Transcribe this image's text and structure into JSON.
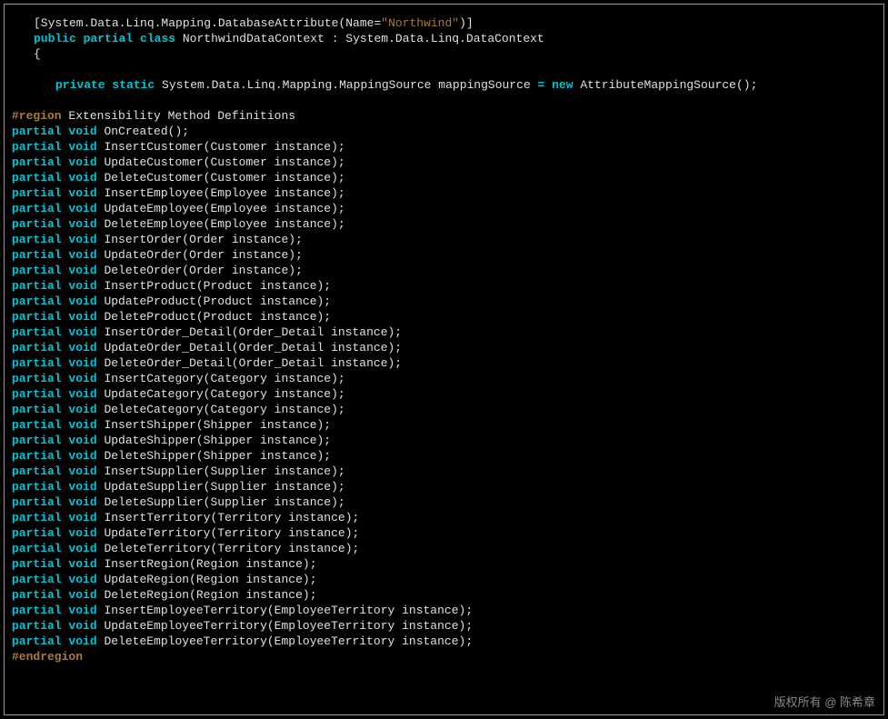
{
  "attr_line": {
    "open": "[System.Data.Linq.Mapping.DatabaseAttribute(Name=",
    "str": "\"Northwind\"",
    "close": ")]"
  },
  "class_line": {
    "k1": "public",
    "k2": "partial",
    "k3": "class",
    "name": " NorthwindDataContext : System.Data.Linq.DataContext"
  },
  "brace": "{",
  "field_line": {
    "k1": "private",
    "k2": "static",
    "type": " System.Data.Linq.Mapping.MappingSource mappingSource ",
    "eq": "=",
    "k3": " new",
    "rest": " AttributeMappingSource();"
  },
  "region": {
    "kw": "#region",
    "txt": " Extensibility Method Definitions"
  },
  "partials": [
    "OnCreated();",
    "InsertCustomer(Customer instance);",
    "UpdateCustomer(Customer instance);",
    "DeleteCustomer(Customer instance);",
    "InsertEmployee(Employee instance);",
    "UpdateEmployee(Employee instance);",
    "DeleteEmployee(Employee instance);",
    "InsertOrder(Order instance);",
    "UpdateOrder(Order instance);",
    "DeleteOrder(Order instance);",
    "InsertProduct(Product instance);",
    "UpdateProduct(Product instance);",
    "DeleteProduct(Product instance);",
    "InsertOrder_Detail(Order_Detail instance);",
    "UpdateOrder_Detail(Order_Detail instance);",
    "DeleteOrder_Detail(Order_Detail instance);",
    "InsertCategory(Category instance);",
    "UpdateCategory(Category instance);",
    "DeleteCategory(Category instance);",
    "InsertShipper(Shipper instance);",
    "UpdateShipper(Shipper instance);",
    "DeleteShipper(Shipper instance);",
    "InsertSupplier(Supplier instance);",
    "UpdateSupplier(Supplier instance);",
    "DeleteSupplier(Supplier instance);",
    "InsertTerritory(Territory instance);",
    "UpdateTerritory(Territory instance);",
    "DeleteTerritory(Territory instance);",
    "InsertRegion(Region instance);",
    "UpdateRegion(Region instance);",
    "DeleteRegion(Region instance);",
    "InsertEmployeeTerritory(EmployeeTerritory instance);",
    "UpdateEmployeeTerritory(EmployeeTerritory instance);",
    "DeleteEmployeeTerritory(EmployeeTerritory instance);"
  ],
  "pk1": "partial",
  "pk2": "void",
  "endregion": "#endregion",
  "watermark": "版权所有 @ 陈希章"
}
